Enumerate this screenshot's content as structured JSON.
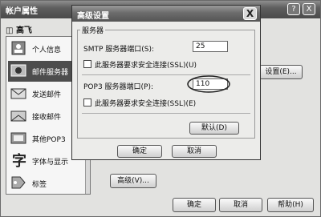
{
  "window": {
    "title": "帐户属性",
    "help_btn": "?",
    "close_btn": "X"
  },
  "user_name": "高飞",
  "sidebar": {
    "items": [
      {
        "label": "个人信息",
        "icon": "personal-info-icon"
      },
      {
        "label": "邮件服务器",
        "icon": "mail-server-icon"
      },
      {
        "label": "发送邮件",
        "icon": "send-mail-icon"
      },
      {
        "label": "接收邮件",
        "icon": "receive-mail-icon"
      },
      {
        "label": "其他POP3",
        "icon": "other-pop3-icon"
      },
      {
        "label": "字体与显示",
        "icon": "font-display-icon"
      },
      {
        "label": "标签",
        "icon": "tag-icon"
      }
    ]
  },
  "main": {
    "settings_button": "设置(E)...",
    "advanced_button": "高级(V)...",
    "ok": "确定",
    "cancel": "取消",
    "help": "帮助(H)"
  },
  "dialog": {
    "title": "高级设置",
    "close": "X",
    "group_label": "服务器",
    "smtp_label": "SMTP 服务器端口(S):",
    "smtp_value": "25",
    "smtp_ssl": "此服务器要求安全连接(SSL)(U)",
    "pop3_label": "POP3 服务器端口(P):",
    "pop3_value": "110",
    "pop3_ssl": "此服务器要求安全连接(SSL)(E)",
    "default_button": "默认(D)",
    "ok": "确定",
    "cancel": "取消"
  }
}
